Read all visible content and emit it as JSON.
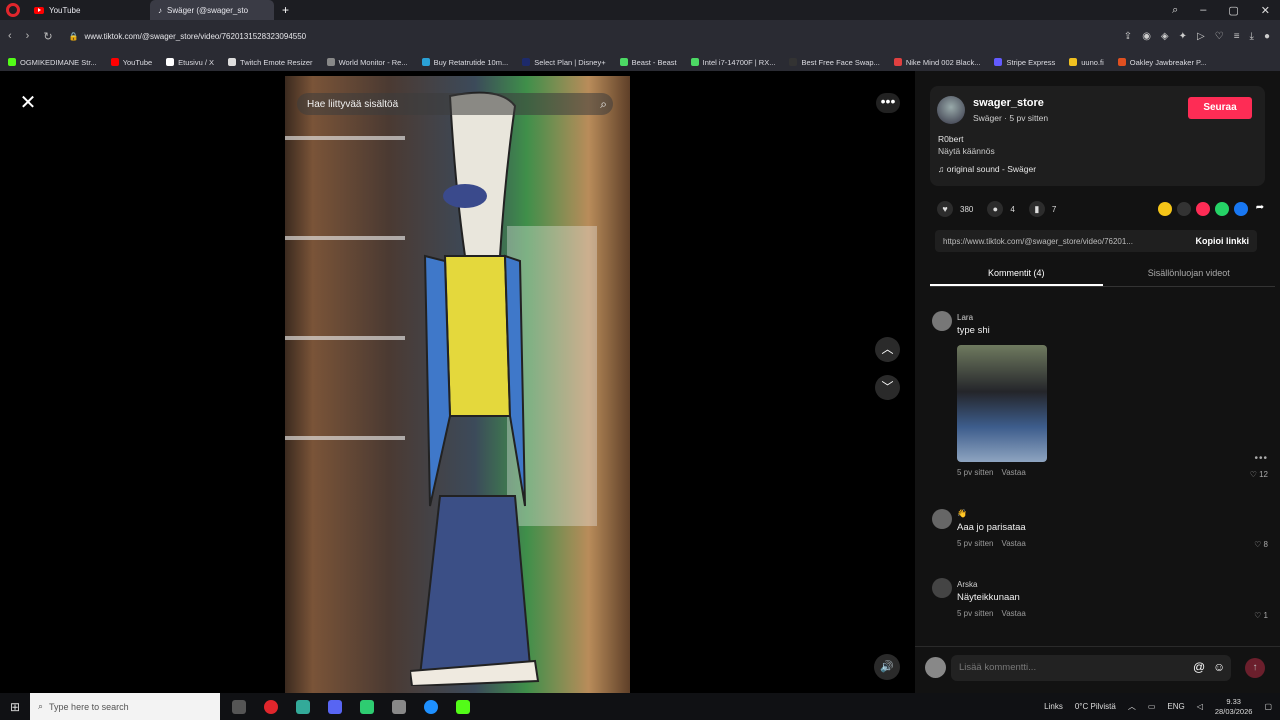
{
  "browser": {
    "tabs": [
      {
        "label": "YouTube",
        "active": false
      },
      {
        "label": "Swäger (@swager_sto",
        "active": true
      }
    ],
    "new_tab": "+",
    "url": "www.tiktok.com/@swager_store/video/7620131528323094550",
    "bookmarks": [
      {
        "label": "OGMIKEDIMANE Str...",
        "color": "#53fc18"
      },
      {
        "label": "YouTube",
        "color": "#ff0000"
      },
      {
        "label": "Etusivu / X",
        "color": "#ffffff"
      },
      {
        "label": "Twitch Emote Resizer",
        "color": "#dddddd"
      },
      {
        "label": "World Monitor - Re...",
        "color": "#888888"
      },
      {
        "label": "Buy Retatrutide 10m...",
        "color": "#2aa1d6"
      },
      {
        "label": "Select Plan | Disney+",
        "color": "#1d2a6b"
      },
      {
        "label": "Beast - Beast",
        "color": "#4cd964"
      },
      {
        "label": "Intel i7-14700F | RX...",
        "color": "#4cd964"
      },
      {
        "label": "Best Free Face Swap...",
        "color": "#333333"
      },
      {
        "label": "Nike Mind 002 Black...",
        "color": "#e04040"
      },
      {
        "label": "Stripe Express",
        "color": "#635bff"
      },
      {
        "label": "uuno.fi",
        "color": "#f0c020"
      },
      {
        "label": "Oakley Jawbreaker P...",
        "color": "#e05020"
      }
    ]
  },
  "viewer": {
    "search_placeholder": "Hae liittyvää sisältöä",
    "close_label": "✕",
    "more_label": "•••",
    "up_label": "︿",
    "down_label": "﹀",
    "volume_label": "🔊"
  },
  "panel": {
    "username": "swager_store",
    "subtitle": "Swäger · 5 pv sitten",
    "follow_label": "Seuraa",
    "description": "R0bert",
    "translate": "Näytä käännös",
    "sound": "♫  original sound - Swäger",
    "likes": "380",
    "comments_count": "4",
    "saves": "7",
    "link": "https://www.tiktok.com/@swager_store/video/76201...",
    "copy_link": "Kopioi linkki",
    "tab_comments": "Kommentit (4)",
    "tab_creator": "Sisällönluojan videot",
    "comments": [
      {
        "name": "Lara",
        "text": "type shi",
        "time": "5 pv sitten",
        "reply": "Vastaa",
        "likes": "12",
        "has_image": true
      },
      {
        "name": "👋",
        "text": "Aaa jo parisataa",
        "time": "5 pv sitten",
        "reply": "Vastaa",
        "likes": "8",
        "has_image": false
      },
      {
        "name": "Arska",
        "text": "Näyteikkunaan",
        "time": "5 pv sitten",
        "reply": "Vastaa",
        "likes": "1",
        "has_image": false
      }
    ],
    "comment_placeholder": "Lisää kommentti...",
    "comment_more": "•••"
  },
  "taskbar": {
    "search_placeholder": "Type here to search",
    "links": "Links",
    "weather": "0°C  Pilvistä",
    "lang": "ENG",
    "time": "9.33",
    "date": "28/03/2026"
  },
  "colors": {
    "accent": "#fe2c55"
  }
}
